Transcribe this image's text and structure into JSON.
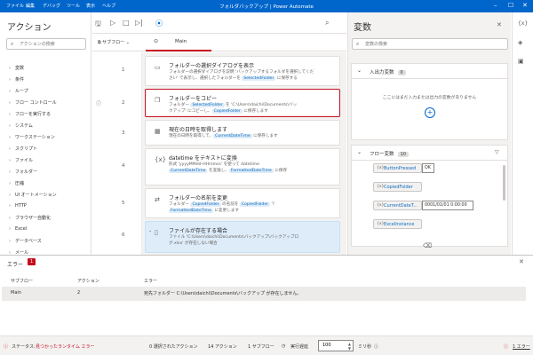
{
  "titlebar": {
    "menu": [
      "ファイル",
      "編集",
      "デバッグ",
      "ツール",
      "表示",
      "ヘルプ"
    ],
    "title": "フォルダバックアップ | Power Automate"
  },
  "actions_panel": {
    "title": "アクション",
    "search_placeholder": "アクションの検索",
    "categories": [
      "変数",
      "条件",
      "ループ",
      "フロー コントロール",
      "フローを実行する",
      "システム",
      "ワークステーション",
      "スクリプト",
      "ファイル",
      "フォルダー",
      "圧縮",
      "UI オートメーション",
      "HTTP",
      "ブラウザー自動化",
      "Excel",
      "データベース",
      "メール"
    ]
  },
  "editor": {
    "subflow_label": "サブフロー",
    "main_tab": "Main",
    "line_numbers": [
      "1",
      "2",
      "3",
      "4",
      "5",
      "6"
    ],
    "actions": [
      {
        "title": "フォルダーの選択ダイアログを表示",
        "desc1": "フォルダーの選択ダイアログを説明 'バックアップするフォルダを選択してくだ",
        "desc2": "さい' で表示し、選択したフォルダーを ",
        "var1": "SelectedFolder",
        "desc3": " に保存する"
      },
      {
        "title": "フォルダーをコピー",
        "desc1": "フォルダー ",
        "var1": "SelectedFolder",
        "desc2": " を 'C:\\Users\\daichi\\Documents\\バッ",
        "desc3": "クアップ' にコピーし、",
        "var2": "CopiedFolder",
        "desc4": " に保存します"
      },
      {
        "title": "現在の日時を取得します",
        "desc1": "現在の日時を取得して、",
        "var1": "CurrentDateTime",
        "desc2": " に保存します"
      },
      {
        "title": "datetime をテキストに変換",
        "desc1": "形式 'yyyyMMdd-HHmmss' を使って datetime",
        "var1": "CurrentDateTime",
        "desc2": " を変換し、",
        "var2": "FormattedDateTime",
        "desc3": " に保存"
      },
      {
        "title": "フォルダーの名前を変更",
        "desc1": "フォルダー ",
        "var1": "CopiedFolder",
        "desc2": " の名前を ",
        "var2": "CopiedFolder",
        "desc3": " '\\' ",
        "var3": "FormattedDateTime",
        "desc4": " に変更します"
      },
      {
        "title": "ファイルが存在する場合",
        "desc1": "ファイル 'C:\\Users\\daichi\\Documents\\バックアップ\\バックアップロ",
        "desc2": "グ.xlsx' が存在しない場合"
      }
    ]
  },
  "variables_panel": {
    "title": "変数",
    "search_placeholder": "変数の検索",
    "input_section": "入出力変数",
    "input_count": "0",
    "input_empty": "ここにはまだ入力または出力の変数がありません",
    "flow_section": "フロー変数",
    "flow_count": "10",
    "flow_vars": [
      {
        "name": "ButtonPressed",
        "value": "OK"
      },
      {
        "name": "CopiedFolder",
        "value": ""
      },
      {
        "name": "CurrentDateT...",
        "value": "0001/01/01 0:00:00"
      },
      {
        "name": "ExcelInstance",
        "value": ""
      }
    ]
  },
  "error_pane": {
    "title": "エラー",
    "count": "1",
    "headers": [
      "サブフロー",
      "アクション",
      "エラー"
    ],
    "rows": [
      {
        "subflow": "Main",
        "action": "2",
        "error": "宛先フォルダー C:\\Users\\daichi\\Documents\\バックアップ が存在しません。"
      }
    ]
  },
  "statusbar": {
    "status_label": "ステータス:",
    "status_value": "見つかったランタイム エラー",
    "selected": "0 選択されたアクション",
    "actions": "14 アクション",
    "subflows": "1 サブフロー",
    "delay_label": "実行遅延",
    "delay_value": "100",
    "delay_unit": "ミリ秒",
    "errors_link": "1 エラー"
  },
  "colors": {
    "accent": "#0066cc",
    "error": "#c50f1f",
    "var_text": "#0f6cbd"
  }
}
